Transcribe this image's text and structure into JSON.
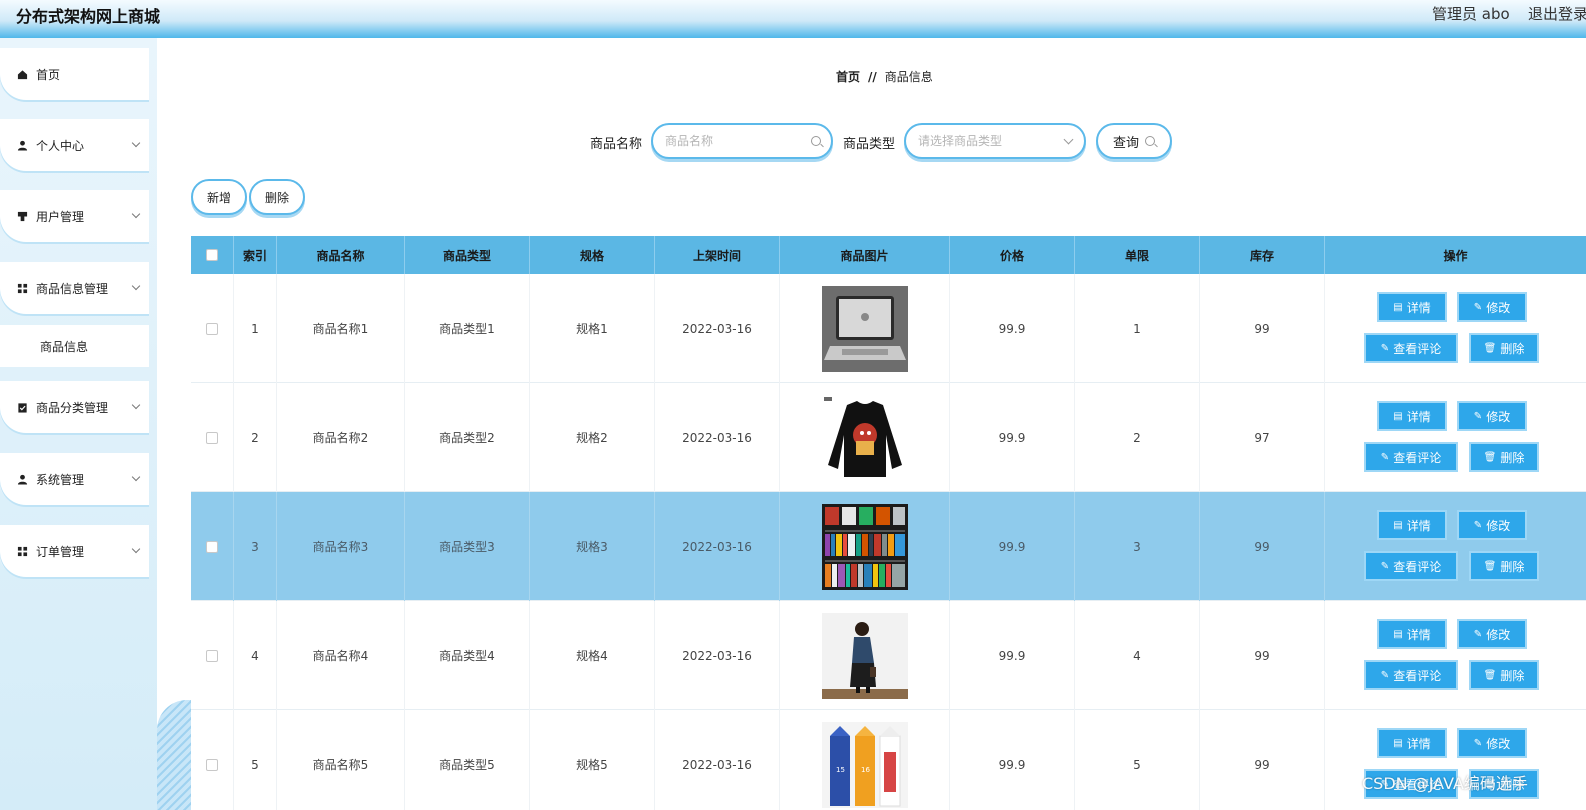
{
  "header": {
    "app_title": "分布式架构网上商城",
    "admin": "管理员 abo",
    "logout": "退出登录"
  },
  "sidebar": {
    "items": [
      {
        "label": "首页",
        "icon": "home-icon",
        "top": 0
      },
      {
        "label": "个人中心",
        "icon": "user-icon"
      },
      {
        "label": "用户管理",
        "icon": "users-icon"
      },
      {
        "label": "商品信息管理",
        "icon": "grid-icon"
      },
      {
        "label": "商品分类管理",
        "icon": "clipboard-icon"
      },
      {
        "label": "系统管理",
        "icon": "user-icon"
      },
      {
        "label": "订单管理",
        "icon": "grid-icon"
      }
    ],
    "sub_item": "商品信息"
  },
  "breadcrumb": {
    "home": "首页",
    "sep": "//",
    "current": "商品信息"
  },
  "search": {
    "name_label": "商品名称",
    "name_placeholder": "商品名称",
    "type_label": "商品类型",
    "type_placeholder": "请选择商品类型",
    "query_label": "查询"
  },
  "actions": {
    "add": "新增",
    "delete": "删除"
  },
  "table": {
    "columns": [
      "索引",
      "商品名称",
      "商品类型",
      "规格",
      "上架时间",
      "商品图片",
      "价格",
      "单限",
      "库存",
      "操作"
    ],
    "rows": [
      {
        "index": "1",
        "name": "商品名称1",
        "type": "商品类型1",
        "spec": "规格1",
        "date": "2022-03-16",
        "image": "laptop",
        "price": "99.9",
        "limit": "1",
        "stock": "99"
      },
      {
        "index": "2",
        "name": "商品名称2",
        "type": "商品类型2",
        "spec": "规格2",
        "date": "2022-03-16",
        "image": "tshirt",
        "price": "99.9",
        "limit": "2",
        "stock": "97"
      },
      {
        "index": "3",
        "name": "商品名称3",
        "type": "商品类型3",
        "spec": "规格3",
        "date": "2022-03-16",
        "image": "books",
        "price": "99.9",
        "limit": "3",
        "stock": "99"
      },
      {
        "index": "4",
        "name": "商品名称4",
        "type": "商品类型4",
        "spec": "规格4",
        "date": "2022-03-16",
        "image": "person",
        "price": "99.9",
        "limit": "4",
        "stock": "99"
      },
      {
        "index": "5",
        "name": "商品名称5",
        "type": "商品类型5",
        "spec": "规格5",
        "date": "2022-03-16",
        "image": "cartons",
        "price": "99.9",
        "limit": "5",
        "stock": "99"
      }
    ],
    "op": {
      "detail": "详情",
      "edit": "修改",
      "comments": "查看评论",
      "delete": "删除"
    }
  },
  "watermark": "CSDN @JAVA编码选手",
  "colors": {
    "accent": "#2ea7ea",
    "header_blue": "#4fb7ea",
    "table_header": "#5bb7e4",
    "row_highlight": "#8fcbec"
  }
}
